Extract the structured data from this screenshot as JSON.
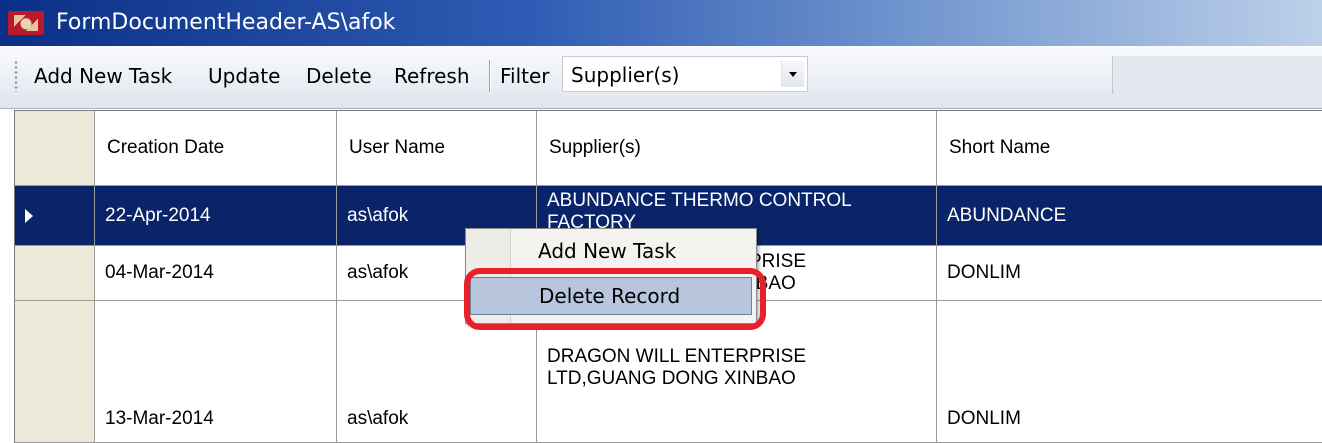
{
  "window": {
    "title": "FormDocumentHeader-AS\\afok",
    "icon": "app-form-icon"
  },
  "toolbar": {
    "add_new_task": "Add New Task",
    "update": "Update",
    "delete": "Delete",
    "refresh": "Refresh",
    "filter_label": "Filter",
    "filter_value": "Supplier(s)"
  },
  "grid": {
    "columns": [
      "Creation Date",
      "User Name",
      "Supplier(s)",
      "Short Name"
    ],
    "rows": [
      {
        "creation_date": "22-Apr-2014",
        "user_name": "as\\afok",
        "supplier": "ABUNDANCE THERMO CONTROL\nFACTORY",
        "short_name": "ABUNDANCE",
        "selected": true
      },
      {
        "creation_date": "04-Mar-2014",
        "user_name": "as\\afok",
        "supplier": "DRAGON WILL ENTERPRISE\nLTD,GUANG DONG XINBAO",
        "short_name": "DONLIM",
        "selected": false
      },
      {
        "creation_date": "13-Mar-2014",
        "user_name": "as\\afok",
        "supplier": "DRAGON WILL ENTERPRISE\nLTD,GUANG DONG XINBAO",
        "short_name": "DONLIM",
        "selected": false
      }
    ]
  },
  "context_menu": {
    "items": [
      "Add New Task",
      "Delete Record"
    ],
    "highlighted_item": "Delete Record"
  },
  "colors": {
    "selection": "#0a246a",
    "title_bar": "#0b2f86",
    "annotation": "#e8202a"
  }
}
